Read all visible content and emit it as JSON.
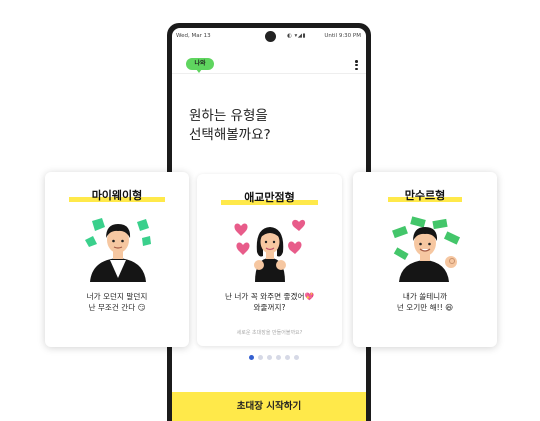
{
  "status_bar": {
    "date": "Wed, Mar 13",
    "right": "Until 9:30 PM"
  },
  "app": {
    "logo_text": "나와"
  },
  "headline": {
    "line1": "원하는 유형을",
    "line2": "선택해볼까요?"
  },
  "carousel": {
    "page_count": 6,
    "active_index": 0
  },
  "cards": [
    {
      "title": "마이웨이형",
      "line1": "너가 오던지 말던지",
      "line2": "난 무조건 간다 😏"
    },
    {
      "title": "애교만점형",
      "line1": "난 너가 꼭 와주면 좋겠어💖",
      "line2": "와줄꺼지?",
      "sub": "세로운 초대장을 만들어볼까요?"
    },
    {
      "title": "만수르형",
      "line1": "내가 쏠테니까",
      "line2": "넌 오기만 해!! 😆"
    }
  ],
  "cta_label": "초대장 시작하기",
  "colors": {
    "accent_yellow": "#ffe94a",
    "logo_green": "#5fd55f",
    "active_dot": "#3560d0"
  }
}
